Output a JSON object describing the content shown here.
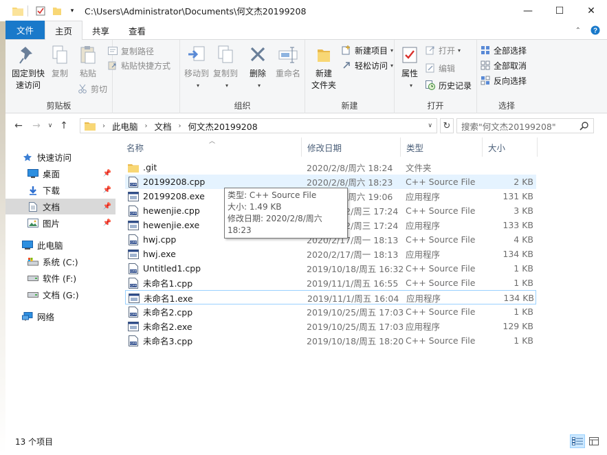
{
  "window": {
    "title_path": "C:\\Users\\Administrator\\Documents\\何文杰20199208",
    "minimize": "—",
    "maximize": "☐",
    "close": "✕"
  },
  "tabs": [
    {
      "label": "文件"
    },
    {
      "label": "主页"
    },
    {
      "label": "共享"
    },
    {
      "label": "查看"
    }
  ],
  "ribbon": {
    "clipboard": {
      "label": "剪贴板",
      "pin_quick_line1": "固定到快",
      "pin_quick_line2": "速访问",
      "copy": "复制",
      "paste": "粘贴",
      "copy_path": "复制路径",
      "paste_shortcut": "粘贴快捷方式",
      "cut": "剪切"
    },
    "organize": {
      "label": "组织",
      "move_to": "移动到",
      "copy_to": "复制到",
      "delete": "删除",
      "rename": "重命名"
    },
    "new": {
      "label": "新建",
      "new_folder_line1": "新建",
      "new_folder_line2": "文件夹",
      "new_item": "新建项目",
      "easy_access": "轻松访问"
    },
    "open": {
      "label": "打开",
      "properties": "属性",
      "open": "打开",
      "edit": "编辑",
      "history": "历史记录"
    },
    "select": {
      "label": "选择",
      "select_all": "全部选择",
      "select_none": "全部取消",
      "invert": "反向选择"
    }
  },
  "address": {
    "crumbs": [
      "此电脑",
      "文档",
      "何文杰20199208"
    ],
    "search_placeholder": "搜索\"何文杰20199208\""
  },
  "navpane": {
    "quick_access": "快速访问",
    "desktop": "桌面",
    "downloads": "下载",
    "documents": "文档",
    "pictures": "图片",
    "this_pc": "此电脑",
    "drive_c": "系统 (C:)",
    "drive_f": "软件 (F:)",
    "drive_g": "文档 (G:)",
    "network": "网络"
  },
  "columns": {
    "name": "名称",
    "date": "修改日期",
    "type": "类型",
    "size": "大小"
  },
  "files": [
    {
      "name": ".git",
      "date": "2020/2/8/周六 18:24",
      "type": "文件夹",
      "size": "",
      "icon": "folder-icon"
    },
    {
      "name": "20199208.cpp",
      "date": "2020/2/8/周六 18:23",
      "type": "C++ Source File",
      "size": "2 KB",
      "icon": "cpp-file-icon"
    },
    {
      "name": "20199208.exe",
      "date": "2020/2/8/周六 19:06",
      "type": "应用程序",
      "size": "131 KB",
      "icon": "exe-file-icon"
    },
    {
      "name": "hewenjie.cpp",
      "date": "2020/2/12/周三 17:24",
      "type": "C++ Source File",
      "size": "3 KB",
      "icon": "cpp-file-icon"
    },
    {
      "name": "hewenjie.exe",
      "date": "2020/2/12/周三 17:24",
      "type": "应用程序",
      "size": "133 KB",
      "icon": "exe-file-icon"
    },
    {
      "name": "hwj.cpp",
      "date": "2020/2/17/周一 18:13",
      "type": "C++ Source File",
      "size": "4 KB",
      "icon": "cpp-file-icon"
    },
    {
      "name": "hwj.exe",
      "date": "2020/2/17/周一 18:13",
      "type": "应用程序",
      "size": "134 KB",
      "icon": "exe-file-icon"
    },
    {
      "name": "Untitled1.cpp",
      "date": "2019/10/18/周五 16:32",
      "type": "C++ Source File",
      "size": "1 KB",
      "icon": "cpp-file-icon"
    },
    {
      "name": "未命名1.cpp",
      "date": "2019/11/1/周五 16:55",
      "type": "C++ Source File",
      "size": "1 KB",
      "icon": "cpp-file-icon"
    },
    {
      "name": "未命名1.exe",
      "date": "2019/11/1/周五 16:04",
      "type": "应用程序",
      "size": "134 KB",
      "icon": "exe-file-icon"
    },
    {
      "name": "未命名2.cpp",
      "date": "2019/10/25/周五 17:03",
      "type": "C++ Source File",
      "size": "1 KB",
      "icon": "cpp-file-icon"
    },
    {
      "name": "未命名2.exe",
      "date": "2019/10/25/周五 17:03",
      "type": "应用程序",
      "size": "129 KB",
      "icon": "exe-file-icon"
    },
    {
      "name": "未命名3.cpp",
      "date": "2019/10/18/周五 18:20",
      "type": "C++ Source File",
      "size": "1 KB",
      "icon": "cpp-file-icon"
    }
  ],
  "tooltip": {
    "line1": "类型: C++ Source File",
    "line2": "大小: 1.49 KB",
    "line3": "修改日期: 2020/2/8/周六 18:23"
  },
  "status": {
    "count": "13 个项目"
  },
  "colors": {
    "file_tab": "#1979ca",
    "hover_row": "#e5f3ff",
    "selected_nav": "#d9d9d9",
    "folder_yellow": "#f8d775"
  }
}
